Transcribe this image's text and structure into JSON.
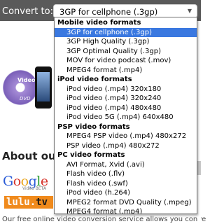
{
  "toolbar": {
    "convert_label": "Convert to:",
    "selected_value": "3GP for cellphone (.3gp)",
    "arrow_glyph": "▼"
  },
  "background": {
    "disc_label": "Video",
    "disc_mark": "DVD",
    "about_heading": "About our",
    "google_letters": [
      "G",
      "o",
      "o",
      "g",
      "l",
      "e"
    ],
    "google_sub": "Video BETA",
    "lulu_text": "lulu.",
    "lulu_tv": "tv",
    "footer_text": "Our free online video conversion service allows you conve"
  },
  "dropdown": {
    "groups": [
      {
        "label": "Mobile video formats",
        "options": [
          "3GP for cellphone (.3gp)",
          "3GP High Quality (.3gp)",
          "3GP Optimal Quality (.3gp)",
          "MOV for video podcast (.mov)",
          "MPEG4 format (.mp4)"
        ]
      },
      {
        "label": "iPod video formats",
        "options": [
          "iPod video (.mp4) 320x180",
          "iPod video (.mp4) 320x240",
          "iPod video (.mp4) 480x480",
          "iPod video 5G (.mp4) 640x480"
        ]
      },
      {
        "label": "PSP video formats",
        "options": [
          "MPEG4 PSP video (.mp4) 480x272",
          "PSP video (.mp4) 480x272"
        ]
      },
      {
        "label": "PC video formats",
        "options": [
          "AVI Format, Xvid (.avi)",
          "Flash video (.flv)",
          "Flash video (.swf)",
          "iPod video (h.264)",
          "MPEG2 format DVD Quality (.mpeg)",
          "MPEG4 format (.mp4)",
          "Windows video (.wmv)"
        ]
      }
    ],
    "selected_group": 0,
    "selected_option": 0
  },
  "colors": {
    "topbar": "#5a5a5a",
    "selection": "#3a78e0"
  }
}
